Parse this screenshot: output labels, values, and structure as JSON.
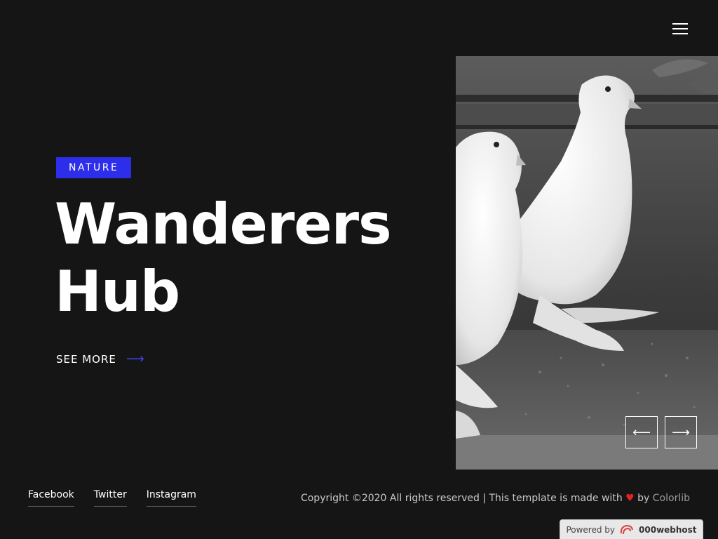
{
  "header": {
    "menu_icon": "hamburger-menu-icon"
  },
  "hero": {
    "badge": "NATURE",
    "title_line1": "Wanderers",
    "title_line2": "Hub",
    "cta_label": "SEE MORE",
    "cta_icon": "arrow-right-icon",
    "accent_color": "#2c2eea"
  },
  "slider": {
    "prev_icon": "arrow-left-icon",
    "next_icon": "arrow-right-icon",
    "prev_glyph": "⟵",
    "next_glyph": "⟶"
  },
  "footer": {
    "social": [
      "Facebook",
      "Twitter",
      "Instagram"
    ],
    "copyright_text": "Copyright ©2020 All rights reserved | This template is made with",
    "heart_glyph": "♥",
    "by_text": "by",
    "author": "Colorlib"
  },
  "powered_by": {
    "label": "Powered by",
    "brand": "000webhost"
  }
}
